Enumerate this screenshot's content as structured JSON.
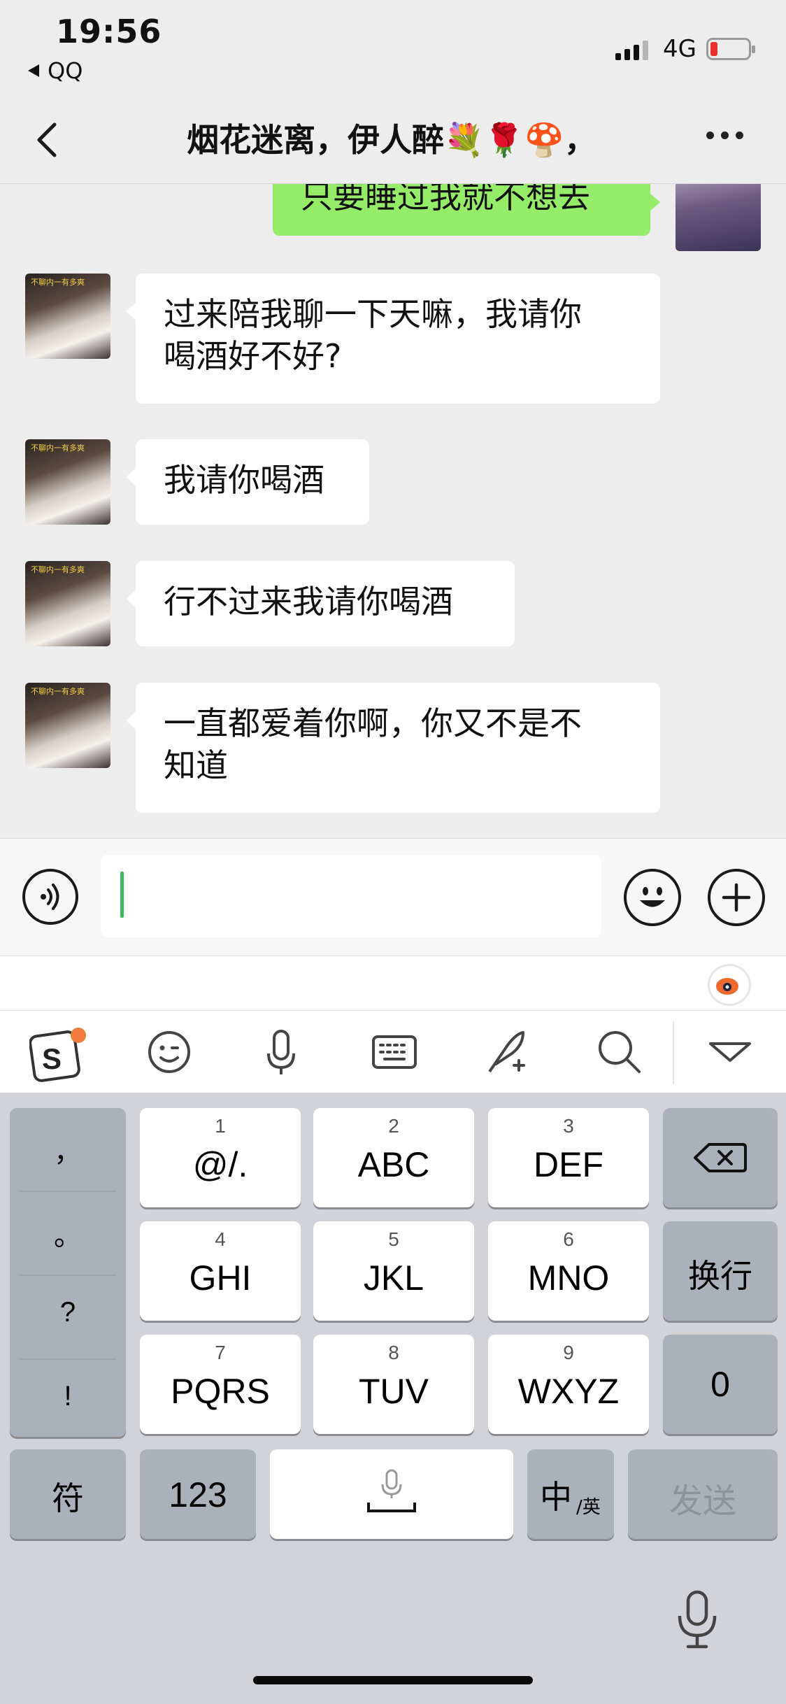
{
  "status_bar": {
    "time": "19:56",
    "back_app": "QQ",
    "network": "4G"
  },
  "header": {
    "title": "烟花迷离，伊人醉💐🌹🍄，"
  },
  "chat": {
    "outgoing": [
      {
        "text": "只要睡过我就不想去"
      }
    ],
    "incoming": [
      {
        "lines": [
          "过来陪我聊一下天嘛，我请你",
          "喝酒好不好?"
        ]
      },
      {
        "lines": [
          "我请你喝酒"
        ]
      },
      {
        "lines": [
          "行不过来我请你喝酒"
        ]
      },
      {
        "lines": [
          "一直都爱着你啊，你又不是不",
          "知道"
        ]
      }
    ],
    "avatar_caption": "不聊内一有多爽"
  },
  "input": {
    "value": ""
  },
  "keyboard": {
    "punctuation": [
      "，",
      "。",
      "?",
      "!"
    ],
    "keys": [
      {
        "num": "1",
        "label": "@/."
      },
      {
        "num": "2",
        "label": "ABC"
      },
      {
        "num": "3",
        "label": "DEF"
      },
      {
        "num": "4",
        "label": "GHI"
      },
      {
        "num": "5",
        "label": "JKL"
      },
      {
        "num": "6",
        "label": "MNO"
      },
      {
        "num": "7",
        "label": "PQRS"
      },
      {
        "num": "8",
        "label": "TUV"
      },
      {
        "num": "9",
        "label": "WXYZ"
      }
    ],
    "return_label": "换行",
    "zero_label": "0",
    "symbol_label": "符",
    "numeric_label": "123",
    "lang_main": "中",
    "lang_sub": "/英",
    "send_label": "发送"
  },
  "icons": [
    "back-chevron-icon",
    "more-icon",
    "voice-icon",
    "emoji-icon",
    "plus-icon",
    "sogou-logo-icon",
    "smile-icon",
    "microphone-icon",
    "keyboard-icon",
    "handwriting-icon",
    "search-icon",
    "collapse-icon",
    "backspace-icon",
    "dictation-icon"
  ],
  "colors": {
    "outgoing_bubble": "#95ec69",
    "caret": "#3dbb5a",
    "battery_low": "#e8302c"
  }
}
